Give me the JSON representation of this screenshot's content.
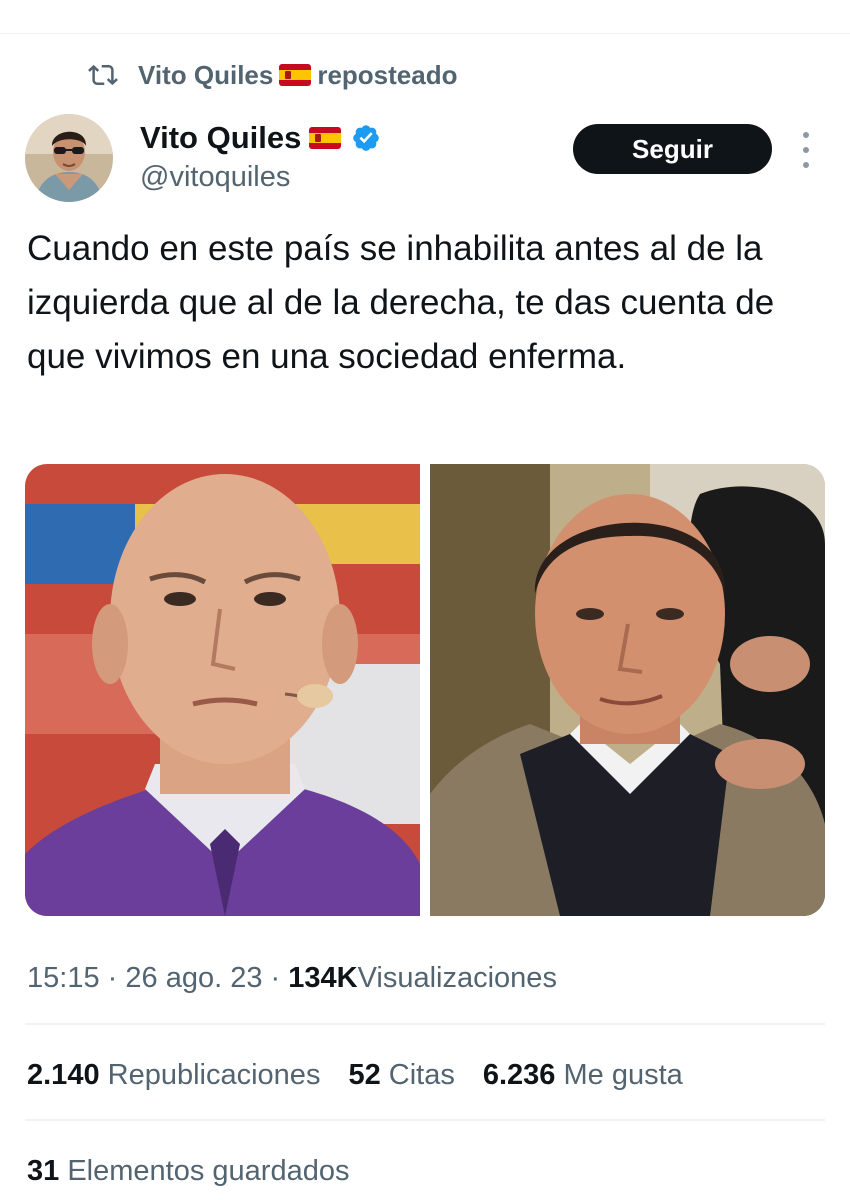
{
  "repost": {
    "reposter_name": "Vito Quiles",
    "suffix": "reposteado"
  },
  "author": {
    "display_name": "Vito Quiles",
    "handle": "@vitoquiles",
    "flag_icon": "spain-flag-emoji",
    "verified_icon": "verified-badge-icon"
  },
  "follow_button_label": "Seguir",
  "tweet": {
    "text": "Cuando en este país se inhabilita antes al de la izquierda que al de la derecha, te das cuenta de que vivimos en una sociedad enferma."
  },
  "media": [
    {
      "name": "photo-left"
    },
    {
      "name": "photo-right"
    }
  ],
  "meta": {
    "time": "15:15",
    "separator": "·",
    "date": "26 ago. 23",
    "views_count": "134K",
    "views_label": "Visualizaciones"
  },
  "stats": {
    "reposts_count": "2.140",
    "reposts_label": "Republicaciones",
    "quotes_count": "52",
    "quotes_label": "Citas",
    "likes_count": "6.236",
    "likes_label": "Me gusta"
  },
  "bookmarks": {
    "count": "31",
    "label": "Elementos guardados"
  },
  "colors": {
    "text_primary": "#0f1419",
    "text_secondary": "#536471",
    "verified_blue": "#1d9bf0",
    "divider": "#eff3f4"
  }
}
